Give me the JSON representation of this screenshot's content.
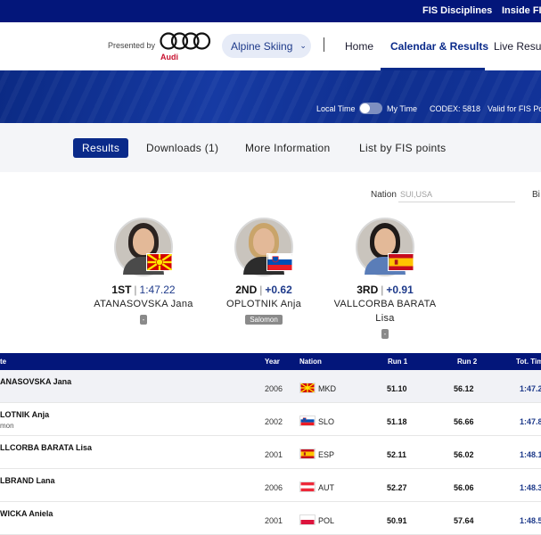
{
  "topbar": {
    "links": [
      "FIS Disciplines",
      "Inside FIS"
    ]
  },
  "nav": {
    "presented_by": "Presented by",
    "sponsor": "Audi",
    "discipline_selector": "Alpine Skiing",
    "links": [
      "Home",
      "Calendar & Results",
      "Live Results"
    ],
    "active_link": "Calendar & Results"
  },
  "hero": {
    "local_time": "Local Time",
    "my_time": "My Time",
    "codex": "CODEX: 5818",
    "valid_for": "Valid for FIS Po"
  },
  "tabs": {
    "items": [
      "Results",
      "Downloads (1)",
      "More Information",
      "List by FIS points"
    ],
    "active": "Results"
  },
  "filters": {
    "nation_label": "Nation",
    "nation_placeholder": "SUI,USA",
    "next_label": "Bi"
  },
  "podium": [
    {
      "rank": "1ST",
      "time": "1:47.22",
      "name": "ATANASOVSKA Jana",
      "name2": "",
      "brand": "-",
      "flag_color": "#d20000"
    },
    {
      "rank": "2ND",
      "time": "+0.62",
      "name": "OPLOTNIK Anja",
      "name2": "",
      "brand": "Salomon",
      "flag_color": "#0050b5"
    },
    {
      "rank": "3RD",
      "time": "+0.91",
      "name": "VALLCORBA BARATA",
      "name2": "Lisa",
      "brand": "-",
      "flag_color": "#c60b1e"
    }
  ],
  "table": {
    "headers": [
      "te",
      "Year",
      "Nation",
      "Run 1",
      "Run 2",
      "Tot. Tim"
    ],
    "rows": [
      {
        "name": "ANASOVSKA Jana",
        "sub": "",
        "year": "2006",
        "nation": "MKD",
        "run1": "51.10",
        "run2": "56.12",
        "total": "1:47.2"
      },
      {
        "name": "LOTNIK Anja",
        "sub": "mon",
        "year": "2002",
        "nation": "SLO",
        "run1": "51.18",
        "run2": "56.66",
        "total": "1:47.8"
      },
      {
        "name": "LLCORBA BARATA Lisa",
        "sub": "",
        "year": "2001",
        "nation": "ESP",
        "run1": "52.11",
        "run2": "56.02",
        "total": "1:48.1"
      },
      {
        "name": "LBRAND Lana",
        "sub": "",
        "year": "2006",
        "nation": "AUT",
        "run1": "52.27",
        "run2": "56.06",
        "total": "1:48.3"
      },
      {
        "name": "WICKA Aniela",
        "sub": "",
        "year": "2001",
        "nation": "POL",
        "run1": "50.91",
        "run2": "57.64",
        "total": "1:48.5"
      }
    ]
  },
  "colors": {
    "brand_navy": "#03167a",
    "accent_blue": "#1e3a8a"
  }
}
